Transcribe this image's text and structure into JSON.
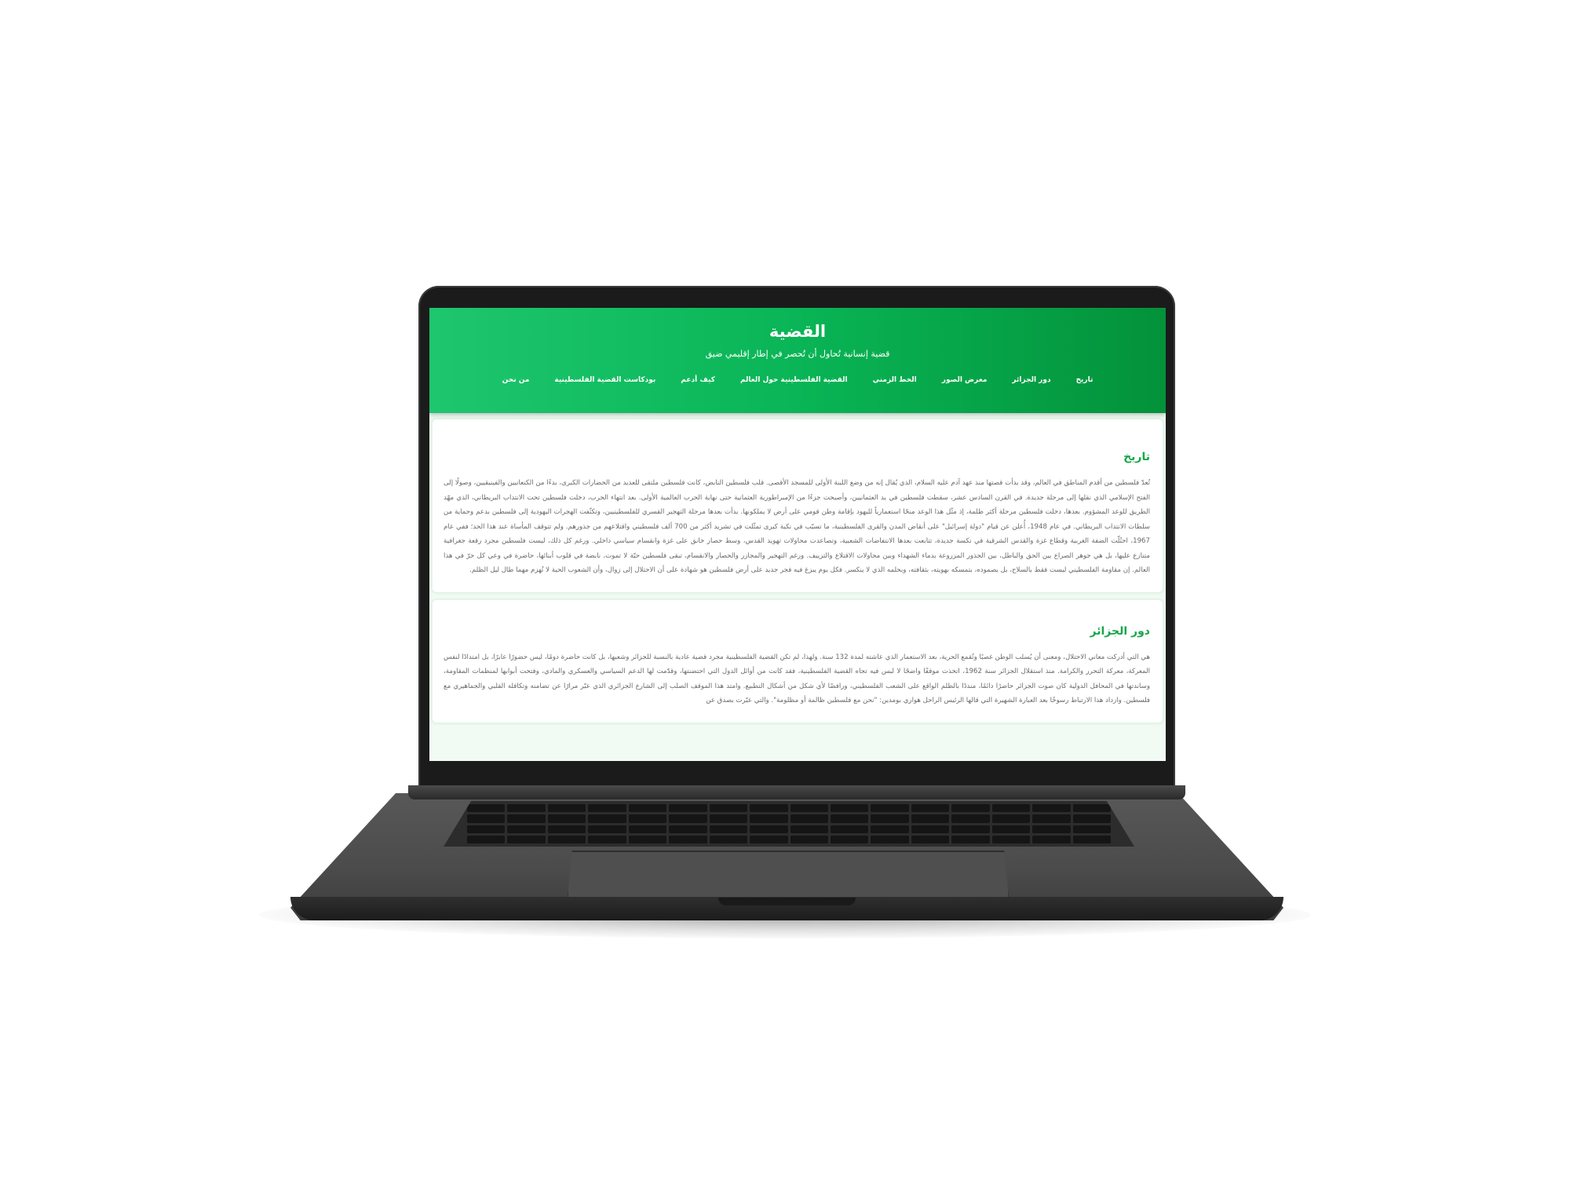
{
  "site": {
    "title": "القضية",
    "subtitle": "قضية إنسانية تُحاول أن تُحصر في إطار إقليمي ضيق"
  },
  "nav": {
    "items": [
      {
        "label": "تاريخ"
      },
      {
        "label": "دور الجزائر"
      },
      {
        "label": "معرض الصور"
      },
      {
        "label": "الخط الزمني"
      },
      {
        "label": "القضية الفلسطينية حول العالم"
      },
      {
        "label": "كيف أدعم"
      },
      {
        "label": "بودكاست القضية الفلسطينية"
      },
      {
        "label": "من نحن"
      }
    ]
  },
  "sections": [
    {
      "title": "تاريخ",
      "body": "تُعدّ فلسطين من أقدم المناطق في العالم، وقد بدأت قصتها منذ عهد آدم عليه السلام، الذي يُقال إنه من وضع اللبنة الأولى للمسجد الأقصى. قلب فلسطين النابض، كانت فلسطين ملتقى للعديد من الحضارات الكبرى، بدءًا من الكنعانيين والفينيقيين، وصولًا إلى الفتح الإسلامي الذي نقلها إلى مرحلة جديدة. في القرن السادس عشر، سقطت فلسطين في يد العثمانيين، وأصبحت جزءًا من الإمبراطورية العثمانية حتى نهاية الحرب العالمية الأولى. بعد انتهاء الحرب، دخلت فلسطين تحت الانتداب البريطاني، الذي مهّد الطريق للوعد المشؤوم. بعدها، دخلت فلسطين مرحلة أكثر ظلمة، إذ مثّل هذا الوعد منحًا استعمارياً لليهود بإقامة وطن قومي على أرض لا يملكونها. بدأت بعدها مرحلة التهجير القسري للفلسطينيين، وتكثّفت الهجرات اليهودية إلى فلسطين بدعم وحماية من سلطات الانتداب البريطاني. في عام 1948، أُعلن عن قيام \"دولة إسرائيل\" على أنقاض المدن والقرى الفلسطينية، ما تسبّب في نكبة كبرى تمثّلت في تشريد أكثر من 700 ألف فلسطيني واقتلاعهم من جذورهم. ولم تتوقف المأساة عند هذا الحد؛ ففي عام 1967، احتُلّت الضفة الغربية وقطاع غزة والقدس الشرقية في نكسة جديدة، تتابعت بعدها الانتفاضات الشعبية، وتصاعدت محاولات تهويد القدس، وسط حصار خانق على غزة وانقسام سياسي داخلي. ورغم كل ذلك، ليست فلسطين مجرد رقعة جغرافية متنازع عليها، بل هي جوهر الصراع بين الحق والباطل، بين الجذور المزروعة بدماء الشهداء وبين محاولات الاقتلاع والتزييف. ورغم التهجير والمجازر والحصار والانقسام، تبقى فلسطين حيّة لا تموت، نابضة في قلوب أبنائها، حاضرة في وعي كل حرّ في هذا العالم. إن مقاومة الفلسطيني ليست فقط بالسلاح، بل بصموده، بتمسكه بهويته، بثقافته، وبحلمه الذي لا ينكسر. فكل يوم يبزغ فيه فجر جديد على أرض فلسطين هو شهادة على أن الاحتلال إلى زوال، وأن الشعوب الحية لا تُهزم مهما طال ليل الظلم."
    },
    {
      "title": "دور الجزائر",
      "body": "هي التي أدركت معاني الاحتلال، ومعنى أن يُسلب الوطن غصبًا وتُقمع الحرية، بعد الاستعمار الذي عاشته لمدة 132 سنة. ولهذا، لم تكن القضية الفلسطينية مجرد قضية عادية بالنسبة للجزائر وشعبها، بل كانت حاضرة دومًا، ليس حضورًا عابرًا، بل امتدادًا لنفس المعركة، معركة التحرر والكرامة. منذ استقلال الجزائر سنة 1962، اتخذت موقفًا واضحًا لا لبس فيه تجاه القضية الفلسطينية، فقد كانت من أوائل الدول التي احتضنتها، وقدّمت لها الدعم السياسي والعسكري والمادي، وفتحت أبوابها لمنظمات المقاومة، وساندتها في المحافل الدولية كان صوت الجزائر حاضرًا دائمًا، منددًا بالظلم الواقع على الشعب الفلسطيني، ورافضًا لأي شكل من أشكال التطبيع. وامتد هذا الموقف الصلب إلى الشارع الجزائري الذي عبّر مرارًا عن تضامنه وتكافله القلبي والجماهيري مع فلسطين. وازداد هذا الارتباط رسوخًا بعد العبارة الشهيرة التي قالها الرئيس الراحل هواري بومدين: \"نحن مع فلسطين ظالمة أو مظلومة\". والتي عبّرت بصدق عن"
    }
  ]
}
